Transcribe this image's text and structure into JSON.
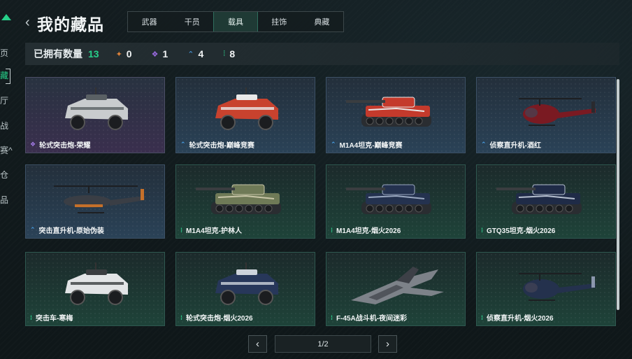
{
  "sidebar": {
    "items": [
      {
        "label": "页",
        "active": false
      },
      {
        "label": "藏",
        "active": true
      },
      {
        "label": "厅",
        "active": false
      },
      {
        "label": "战",
        "active": false
      },
      {
        "label": "赛^",
        "active": false
      },
      {
        "label": "仓",
        "active": false
      },
      {
        "label": "品",
        "active": false
      }
    ]
  },
  "header": {
    "title": "我的藏品",
    "tabs": [
      {
        "label": "武器",
        "active": false
      },
      {
        "label": "干员",
        "active": false
      },
      {
        "label": "载具",
        "active": true
      },
      {
        "label": "挂饰",
        "active": false
      },
      {
        "label": "典藏",
        "active": false
      }
    ]
  },
  "stats": {
    "label": "已拥有数量",
    "total": "13",
    "rarities": [
      {
        "icon": "orange-diamond-icon",
        "color": "#e0833a",
        "count": "0"
      },
      {
        "icon": "purple-diamond-icon",
        "color": "#9a6ae0",
        "count": "1"
      },
      {
        "icon": "blue-chevron-icon",
        "color": "#4a9ee6",
        "count": "4"
      },
      {
        "icon": "green-dots-icon",
        "color": "#2fd08e",
        "count": "8"
      }
    ]
  },
  "items": [
    {
      "name": "轮式突击炮-荣耀",
      "rarity": "purple",
      "icon": "purple-diamond-icon",
      "vehicle": "armored-car-white"
    },
    {
      "name": "轮式突击炮-巅峰竞赛",
      "rarity": "blue",
      "icon": "blue-chevron-icon",
      "vehicle": "armored-car-red"
    },
    {
      "name": "M1A4坦克-巅峰竞赛",
      "rarity": "blue",
      "icon": "blue-chevron-icon",
      "vehicle": "tank-red"
    },
    {
      "name": "侦察直升机-酒红",
      "rarity": "blue",
      "icon": "blue-chevron-icon",
      "vehicle": "heli-red"
    },
    {
      "name": "突击直升机-原始伪装",
      "rarity": "blue",
      "icon": "blue-chevron-icon",
      "vehicle": "attack-heli-camo"
    },
    {
      "name": "M1A4坦克-护林人",
      "rarity": "green",
      "icon": "green-dots-icon",
      "vehicle": "tank-camo"
    },
    {
      "name": "M1A4坦克-烟火2026",
      "rarity": "green",
      "icon": "green-dots-icon",
      "vehicle": "tank-navy"
    },
    {
      "name": "GTQ35坦克-烟火2026",
      "rarity": "green",
      "icon": "green-dots-icon",
      "vehicle": "tank-navy-2"
    },
    {
      "name": "突击车-寒梅",
      "rarity": "green",
      "icon": "green-dots-icon",
      "vehicle": "truck-white"
    },
    {
      "name": "轮式突击炮-烟火2026",
      "rarity": "green",
      "icon": "green-dots-icon",
      "vehicle": "armored-car-navy"
    },
    {
      "name": "F-45A战斗机-夜间迷彩",
      "rarity": "green",
      "icon": "green-dots-icon",
      "vehicle": "jet-camo"
    },
    {
      "name": "侦察直升机-烟火2026",
      "rarity": "green",
      "icon": "green-dots-icon",
      "vehicle": "heli-navy"
    }
  ],
  "pagination": {
    "page": "1/2",
    "prev": "‹",
    "next": "›"
  },
  "colors": {
    "accent": "#27d08a",
    "purple": "#9a6ae0",
    "blue": "#4a9ee6",
    "green": "#2fd08e"
  }
}
